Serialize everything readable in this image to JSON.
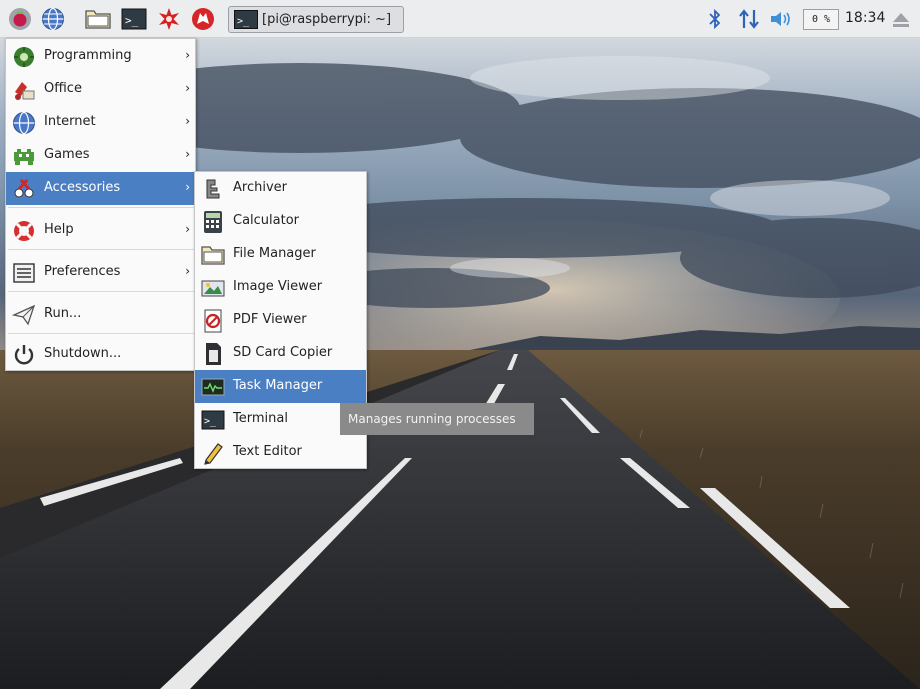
{
  "panel": {
    "launchers": [
      {
        "icon": "raspberry-icon"
      },
      {
        "icon": "web-browser-icon"
      },
      {
        "icon": "file-manager-icon"
      },
      {
        "icon": "terminal-icon"
      },
      {
        "icon": "mathematica-icon"
      },
      {
        "icon": "wolfram-icon"
      }
    ],
    "task_title": "[pi@raspberrypi: ~]",
    "cpu_usage": "0 %",
    "clock": "18:34",
    "tray": [
      "bluetooth-icon",
      "network-icon",
      "volume-icon",
      "eject-icon"
    ]
  },
  "main_menu": {
    "items": [
      {
        "label": "Programming",
        "icon": "programming-icon",
        "submenu": true
      },
      {
        "label": "Office",
        "icon": "office-icon",
        "submenu": true
      },
      {
        "label": "Internet",
        "icon": "globe-icon",
        "submenu": true
      },
      {
        "label": "Games",
        "icon": "games-icon",
        "submenu": true
      },
      {
        "label": "Accessories",
        "icon": "accessories-icon",
        "submenu": true,
        "selected": true
      },
      {
        "label": "Help",
        "icon": "help-icon",
        "submenu": true
      },
      {
        "label": "Preferences",
        "icon": "preferences-icon",
        "submenu": true
      },
      {
        "label": "Run...",
        "icon": "run-icon",
        "submenu": false
      },
      {
        "label": "Shutdown...",
        "icon": "power-icon",
        "submenu": false
      }
    ],
    "arrow": "›"
  },
  "accessories_menu": {
    "items": [
      {
        "label": "Archiver",
        "icon": "archiver-icon"
      },
      {
        "label": "Calculator",
        "icon": "calculator-icon"
      },
      {
        "label": "File Manager",
        "icon": "folder-icon"
      },
      {
        "label": "Image Viewer",
        "icon": "image-viewer-icon"
      },
      {
        "label": "PDF Viewer",
        "icon": "pdf-icon"
      },
      {
        "label": "SD Card Copier",
        "icon": "sd-card-icon"
      },
      {
        "label": "Task Manager",
        "icon": "task-manager-icon",
        "selected": true
      },
      {
        "label": "Terminal",
        "icon": "terminal-icon"
      },
      {
        "label": "Text Editor",
        "icon": "text-editor-icon"
      }
    ]
  },
  "tooltip": "Manages running processes",
  "colors": {
    "selection": "#4b7fc4",
    "panel": "#ecedee",
    "menu": "#fafafa",
    "tooltip": "#8a8a8a"
  }
}
